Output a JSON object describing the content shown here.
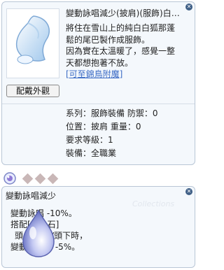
{
  "window1": {
    "title": "變動詠唱減少(披肩)(服飾)白狐尾巴",
    "button_label": "配戴外觀",
    "description_lines": [
      "將住在雪山上的純白白狐那蓬",
      "鬆的尾巴製作成服飾。",
      "因為實在太溫暖了，感覺一整",
      "天都想抱著不放。"
    ],
    "link_text": "[可至錦鳥附魔]",
    "stats": [
      "系列：服飾裝備 防禦：0",
      "位置：披肩 重量：0",
      "要求等級：1",
      "裝備：全職業"
    ]
  },
  "window2": {
    "title": "變動詠唱減少",
    "watermark": "Collections",
    "description_lines": [
      "變動詠唱 -10%。",
      "搭配[變詠石]",
      "頭上/頭中/頭下時，",
      "變動詠唱再 -5%。"
    ]
  },
  "colors": {
    "link": "#3b6bc5",
    "panel_border": "#b9c6d6",
    "close_button": "#3f5f86"
  },
  "icons": {
    "close": "close-icon",
    "card_slot": "card-slot-icon",
    "gem": "gem-icon"
  }
}
